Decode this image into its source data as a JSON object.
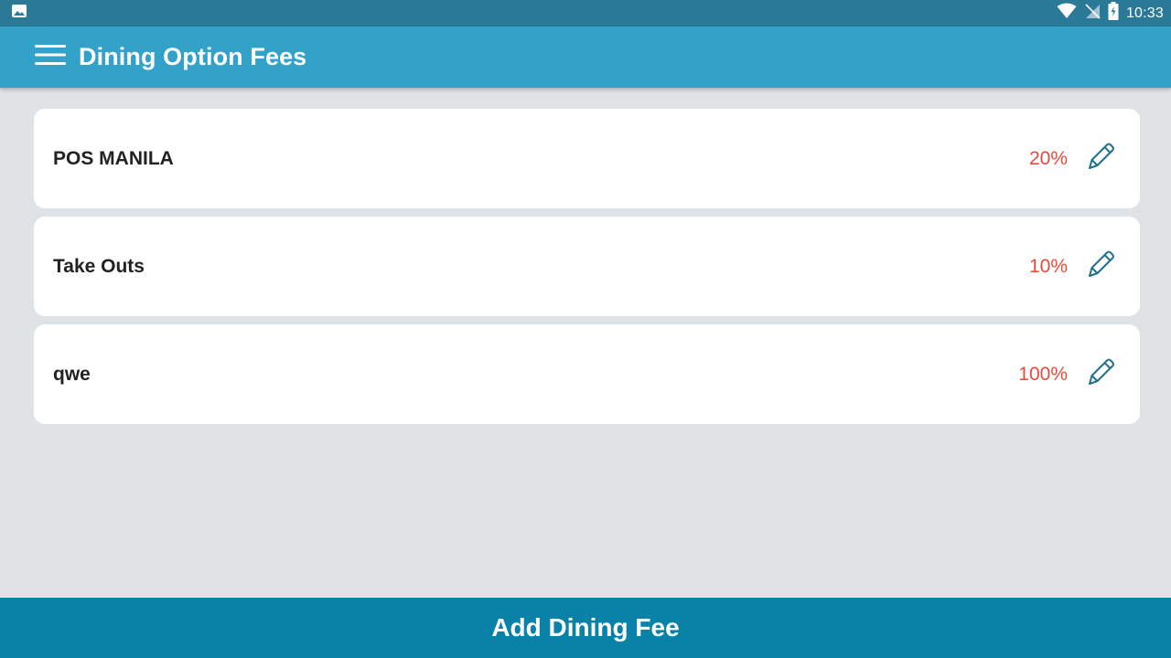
{
  "status_bar": {
    "time": "10:33",
    "icons": [
      "image-icon",
      "wifi-icon",
      "no-signal-icon",
      "battery-charging-icon"
    ]
  },
  "app_bar": {
    "title": "Dining Option Fees",
    "menu_icon": "hamburger-menu-icon"
  },
  "fees": [
    {
      "name": "POS MANILA",
      "fee": "20%",
      "action_icon": "pencil-edit-icon"
    },
    {
      "name": "Take Outs",
      "fee": "10%",
      "action_icon": "pencil-edit-icon"
    },
    {
      "name": "qwe",
      "fee": "100%",
      "action_icon": "pencil-edit-icon"
    }
  ],
  "footer": {
    "add_label": "Add Dining Fee"
  },
  "colors": {
    "status_bar": "#2a7a97",
    "app_bar": "#33a2c9",
    "footer": "#0a82a8",
    "fee_text": "#ea4a3c",
    "edit_icon": "#1f6f8f",
    "background": "#dfe3e6"
  }
}
